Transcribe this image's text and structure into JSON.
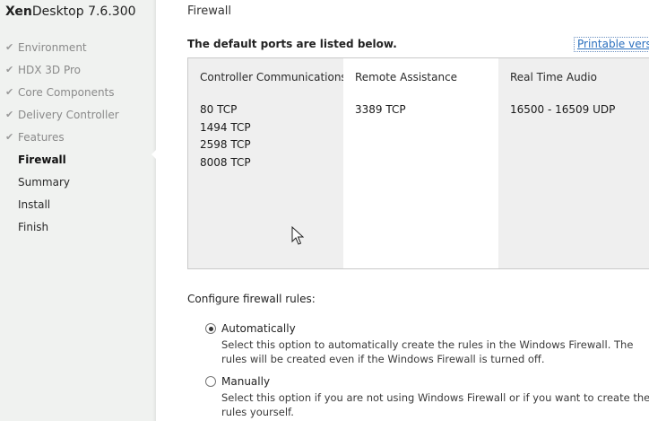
{
  "sidebar": {
    "brand_bold": "Xen",
    "brand_rest": "Desktop 7.6.300",
    "steps": [
      {
        "label": "Environment",
        "state": "done"
      },
      {
        "label": "HDX 3D Pro",
        "state": "done"
      },
      {
        "label": "Core Components",
        "state": "done"
      },
      {
        "label": "Delivery Controller",
        "state": "done"
      },
      {
        "label": "Features",
        "state": "done"
      },
      {
        "label": "Firewall",
        "state": "current"
      },
      {
        "label": "Summary",
        "state": "todo"
      },
      {
        "label": "Install",
        "state": "todo"
      },
      {
        "label": "Finish",
        "state": "todo"
      }
    ]
  },
  "main": {
    "title": "Firewall",
    "intro": "The default ports are listed below.",
    "printable_link": "Printable version",
    "ports": [
      {
        "header": "Controller Communications",
        "items": [
          "80 TCP",
          "1494 TCP",
          "2598 TCP",
          "8008 TCP"
        ]
      },
      {
        "header": "Remote Assistance",
        "items": [
          "3389 TCP"
        ]
      },
      {
        "header": "Real Time Audio",
        "items": [
          "16500 - 16509 UDP"
        ]
      }
    ],
    "configure_label": "Configure firewall rules:",
    "options": [
      {
        "label": "Automatically",
        "selected": true,
        "description": "Select this option to automatically create the rules in the Windows Firewall.  The rules will be created even if the Windows Firewall is turned off."
      },
      {
        "label": "Manually",
        "selected": false,
        "description": "Select this option if you are not using Windows Firewall or if you want to create the rules yourself."
      }
    ]
  },
  "icons": {
    "check": "checkmark-icon",
    "cursor": "mouse-pointer-icon"
  }
}
